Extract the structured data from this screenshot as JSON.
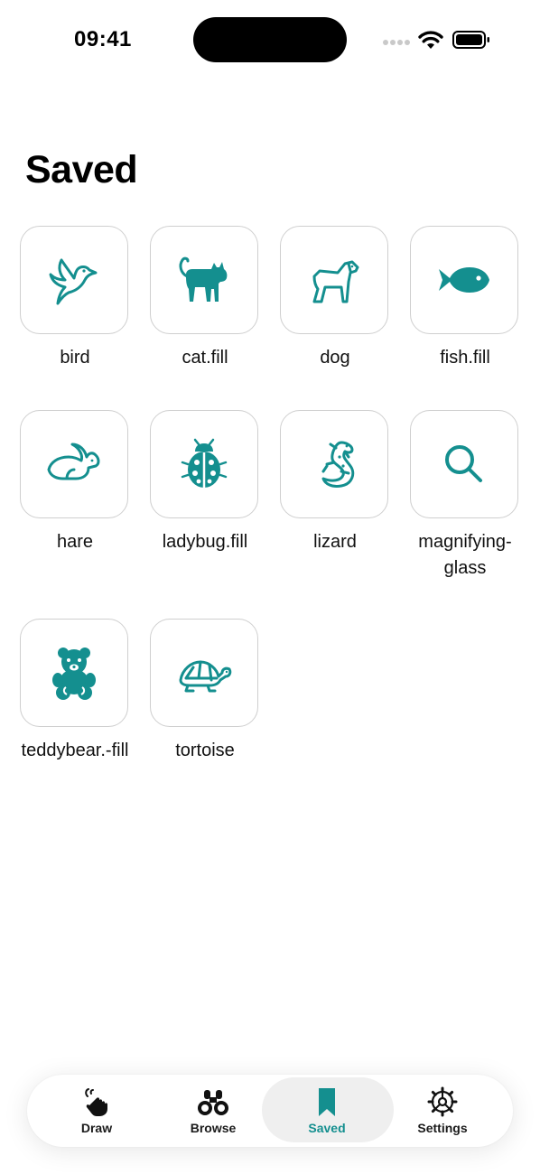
{
  "status_bar": {
    "time": "09:41"
  },
  "page": {
    "title": "Saved"
  },
  "accent_color": "#148F8F",
  "saved_items": [
    {
      "label": "bird",
      "icon": "bird-icon"
    },
    {
      "label": "cat.fill",
      "icon": "cat-icon"
    },
    {
      "label": "dog",
      "icon": "dog-icon"
    },
    {
      "label": "fish.fill",
      "icon": "fish-icon"
    },
    {
      "label": "hare",
      "icon": "hare-icon"
    },
    {
      "label": "ladybug.fill",
      "icon": "ladybug-icon"
    },
    {
      "label": "lizard",
      "icon": "lizard-icon"
    },
    {
      "label": "magnifying-glass",
      "icon": "magnifying-glass-icon"
    },
    {
      "label": "teddybear.-fill",
      "icon": "teddybear-icon"
    },
    {
      "label": "tortoise",
      "icon": "tortoise-icon"
    }
  ],
  "tabbar": {
    "tabs": [
      {
        "label": "Draw",
        "icon": "hand-draw-icon"
      },
      {
        "label": "Browse",
        "icon": "binoculars-icon"
      },
      {
        "label": "Saved",
        "icon": "bookmark-icon",
        "active": true
      },
      {
        "label": "Settings",
        "icon": "gear-icon"
      }
    ]
  }
}
